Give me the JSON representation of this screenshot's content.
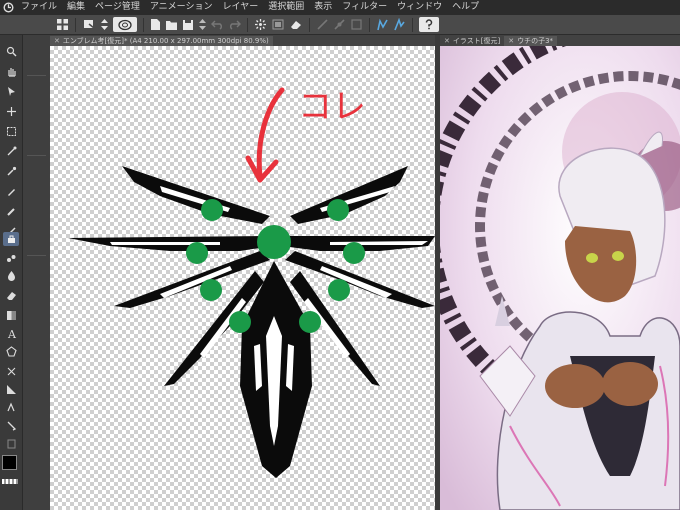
{
  "menu": {
    "items": [
      "ファイル",
      "編集",
      "ページ管理",
      "アニメーション",
      "レイヤー",
      "選択範囲",
      "表示",
      "フィルター",
      "ウィンドウ",
      "ヘルプ"
    ]
  },
  "icons": {
    "app_logo": "clip-studio-logo-icon",
    "command_bar": [
      "grid-icon",
      "undo-history-icon",
      "arrows-icon",
      "rotate-canvas-icon",
      "new-icon",
      "open-icon",
      "save-icon",
      "stepper-icon",
      "undo-icon",
      "redo-icon",
      "sparkle-icon",
      "transform-icon",
      "eraser-icon",
      "ruler-icon",
      "snap-icon",
      "ruler-toggle-icon",
      "pen-icon",
      "pen-alt-icon",
      "help-icon"
    ]
  },
  "tabs": {
    "left_title": "エンブレム考[復元]* (A4 210.00 x 297.00mm 300dpi 80.9%)",
    "right_tab_1": "イラスト[復元]",
    "right_tab_2": "ウチの子3*"
  },
  "canvas": {
    "annotation_text": "コレ",
    "annotation_color": "#e8323c",
    "emblem_color": "#0b0b0b",
    "dot_color": "#1a9a48",
    "checker_light": "#ffffff",
    "checker_dark": "#cfcfcf"
  },
  "colors": {
    "primary_swatch": "#000000",
    "secondary_swatch": "#ffffff"
  }
}
